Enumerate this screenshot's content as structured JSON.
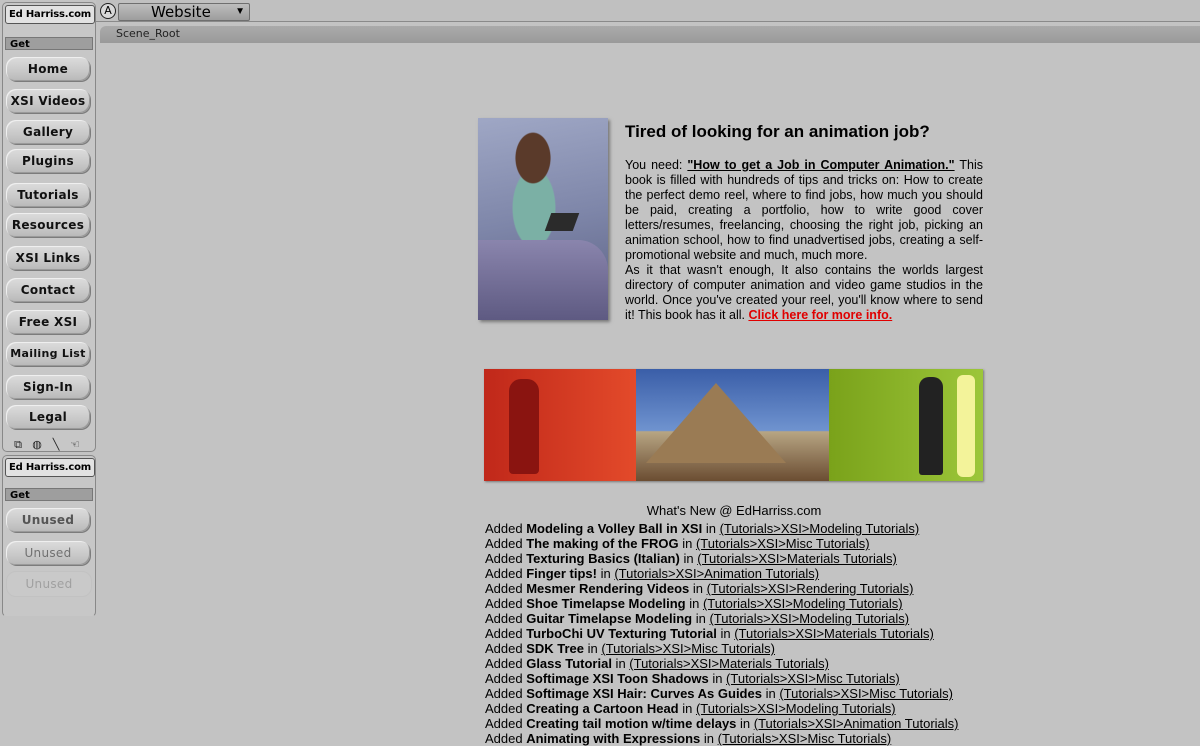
{
  "topbar": {
    "mode_button": "A",
    "website_select": "Website"
  },
  "scene_bar": {
    "label": "Scene_Root"
  },
  "panel1": {
    "title": "Ed Harriss.com",
    "get_label": "Get",
    "buttons": [
      "Home",
      "XSI Videos",
      "Gallery",
      "Plugins",
      "Tutorials",
      "Resources",
      "XSI Links",
      "Contact",
      "Free XSI",
      "Mailing List",
      "Sign-In",
      "Legal"
    ],
    "tool_icons": [
      "cube-icon",
      "sphere-icon",
      "brush-icon",
      "hand-icon"
    ]
  },
  "panel2": {
    "title": "Ed Harriss.com",
    "get_label": "Get",
    "buttons": [
      "Unused",
      "Unused",
      "Unused"
    ]
  },
  "ad": {
    "title": "Tired of looking for an animation job?",
    "you_need": "You need: ",
    "book_title": "\"How to get a Job in Computer Animation.\"",
    "body1": " This book is filled with hundreds of tips and tricks on: How to create the perfect demo reel, where to find jobs, how much you should be paid, creating a portfolio, how to write good cover letters/resumes, freelancing, choosing the right job, picking an animation school, how to find unadvertised jobs, creating a self-promotional website and much, much more.",
    "body2": "As it that wasn't enough, It also contains the worlds largest directory of computer animation and video game studios in the world. Once you've created your reel, you'll know where to send it! This book has it all. ",
    "more_link": "Click here for more info."
  },
  "whats_new": {
    "title": "What's New @ EdHarriss.com",
    "items": [
      {
        "prefix": "Added ",
        "name": "Modeling a Volley Ball in XSI",
        "in": " in ",
        "category": "(Tutorials>XSI>Modeling Tutorials)"
      },
      {
        "prefix": "Added ",
        "name": "The making of the FROG",
        "in": " in ",
        "category": "(Tutorials>XSI>Misc Tutorials)"
      },
      {
        "prefix": "Added ",
        "name": "Texturing Basics (Italian)",
        "in": " in ",
        "category": "(Tutorials>XSI>Materials Tutorials)"
      },
      {
        "prefix": "Added ",
        "name": "Finger tips!",
        "in": " in ",
        "category": "(Tutorials>XSI>Animation Tutorials)"
      },
      {
        "prefix": "Added ",
        "name": "Mesmer Rendering Videos",
        "in": " in ",
        "category": "(Tutorials>XSI>Rendering Tutorials)"
      },
      {
        "prefix": "Added ",
        "name": "Shoe Timelapse Modeling",
        "in": " in ",
        "category": "(Tutorials>XSI>Modeling Tutorials)"
      },
      {
        "prefix": "Added ",
        "name": "Guitar Timelapse Modeling",
        "in": " in ",
        "category": "(Tutorials>XSI>Modeling Tutorials)"
      },
      {
        "prefix": "Added ",
        "name": "TurboChi UV Texturing Tutorial",
        "in": " in ",
        "category": "(Tutorials>XSI>Materials Tutorials)"
      },
      {
        "prefix": "Added ",
        "name": "SDK Tree",
        "in": " in ",
        "category": "(Tutorials>XSI>Misc Tutorials)"
      },
      {
        "prefix": "Added ",
        "name": "Glass Tutorial",
        "in": " in ",
        "category": "(Tutorials>XSI>Materials Tutorials)"
      },
      {
        "prefix": "Added ",
        "name": "Softimage XSI Toon Shadows",
        "in": " in ",
        "category": "(Tutorials>XSI>Misc Tutorials)"
      },
      {
        "prefix": "Added ",
        "name": "Softimage XSI Hair: Curves As Guides",
        "in": " in ",
        "category": "(Tutorials>XSI>Misc Tutorials)"
      },
      {
        "prefix": "Added ",
        "name": "Creating a Cartoon Head",
        "in": " in ",
        "category": "(Tutorials>XSI>Modeling Tutorials)"
      },
      {
        "prefix": "Added ",
        "name": "Creating tail motion w/time delays",
        "in": " in ",
        "category": "(Tutorials>XSI>Animation Tutorials)"
      },
      {
        "prefix": "Added ",
        "name": "Animating with Expressions",
        "in": " in ",
        "category": "(Tutorials>XSI>Misc Tutorials)"
      }
    ]
  },
  "colors": {
    "background": "#c3c3c3",
    "link_red": "#e00000"
  }
}
